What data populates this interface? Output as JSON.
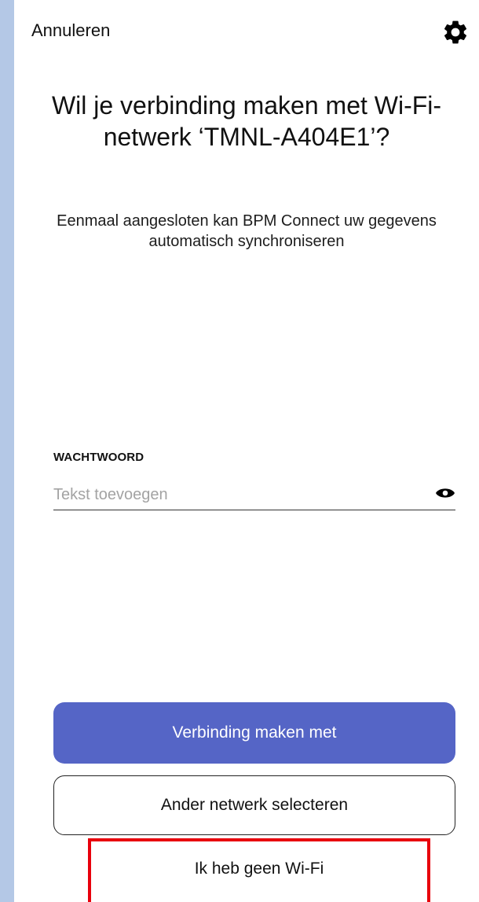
{
  "header": {
    "cancel_label": "Annuleren",
    "settings_icon": "gear-icon"
  },
  "main": {
    "title": "Wil je verbinding maken met Wi-Fi-netwerk ‘TMNL-A404E1’?",
    "subtitle": "Eenmaal aangesloten kan BPM Connect uw gegevens automatisch synchroniseren"
  },
  "password": {
    "label": "WACHTWOORD",
    "value": "",
    "placeholder": "Tekst toevoegen",
    "visibility_icon": "eye-icon"
  },
  "actions": {
    "connect_label": "Verbinding maken met",
    "other_network_label": "Ander netwerk selecteren",
    "no_wifi_label": "Ik heb geen Wi-Fi"
  },
  "colors": {
    "primary": "#5565c6",
    "highlight": "#e8000c",
    "side_bar": "#b4c8e6"
  }
}
